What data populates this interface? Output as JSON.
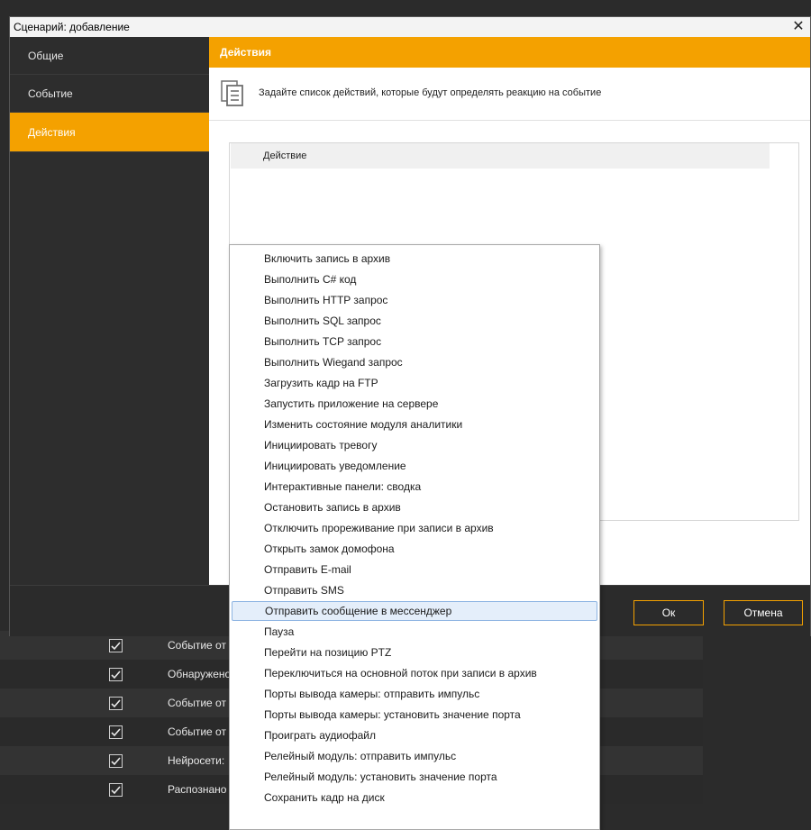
{
  "window": {
    "title": "Сценарий: добавление",
    "close_glyph": "✕"
  },
  "sidebar": {
    "items": [
      {
        "label": "Общие"
      },
      {
        "label": "Событие"
      },
      {
        "label": "Действия",
        "active": true
      }
    ]
  },
  "content": {
    "header": "Действия",
    "info_icon": "document-icon",
    "info_text": "Задайте список действий, которые будут определять реакцию на событие",
    "table": {
      "columns": [
        "Действие"
      ]
    }
  },
  "footer": {
    "ok_label": "Ок",
    "cancel_label": "Отмена"
  },
  "menu": {
    "items": [
      "Включить запись в архив",
      "Выполнить C# код",
      "Выполнить HTTP запрос",
      "Выполнить SQL запрос",
      "Выполнить TCP запрос",
      "Выполнить Wiegand запрос",
      "Загрузить кадр на FTP",
      "Запустить приложение на сервере",
      "Изменить состояние модуля аналитики",
      "Инициировать тревогу",
      "Инициировать уведомление",
      "Интерактивные панели: сводка",
      "Остановить запись в архив",
      "Отключить прореживание при записи в архив",
      "Открыть замок домофона",
      "Отправить E-mail",
      "Отправить SMS",
      "Отправить сообщение в мессенджер",
      "Пауза",
      "Перейти на позицию PTZ",
      "Переключиться на основной поток при записи в архив",
      "Порты вывода камеры: отправить импульс",
      "Порты вывода камеры: установить значение порта",
      "Проиграть аудиофайл",
      "Релейный модуль: отправить импульс",
      "Релейный модуль: установить значение порта",
      "Сохранить кадр на диск"
    ],
    "highlighted_index": 17
  },
  "background_list": {
    "rows": [
      {
        "label": "Событие от",
        "checked": true
      },
      {
        "label": "Обнаружено",
        "checked": true
      },
      {
        "label": "Событие от",
        "checked": true
      },
      {
        "label": "Событие от",
        "checked": true
      },
      {
        "label": "Нейросети:",
        "checked": true
      },
      {
        "label": "Распознано",
        "checked": true
      }
    ]
  },
  "colors": {
    "accent": "#f4a100",
    "highlight": "#e4eefa"
  }
}
